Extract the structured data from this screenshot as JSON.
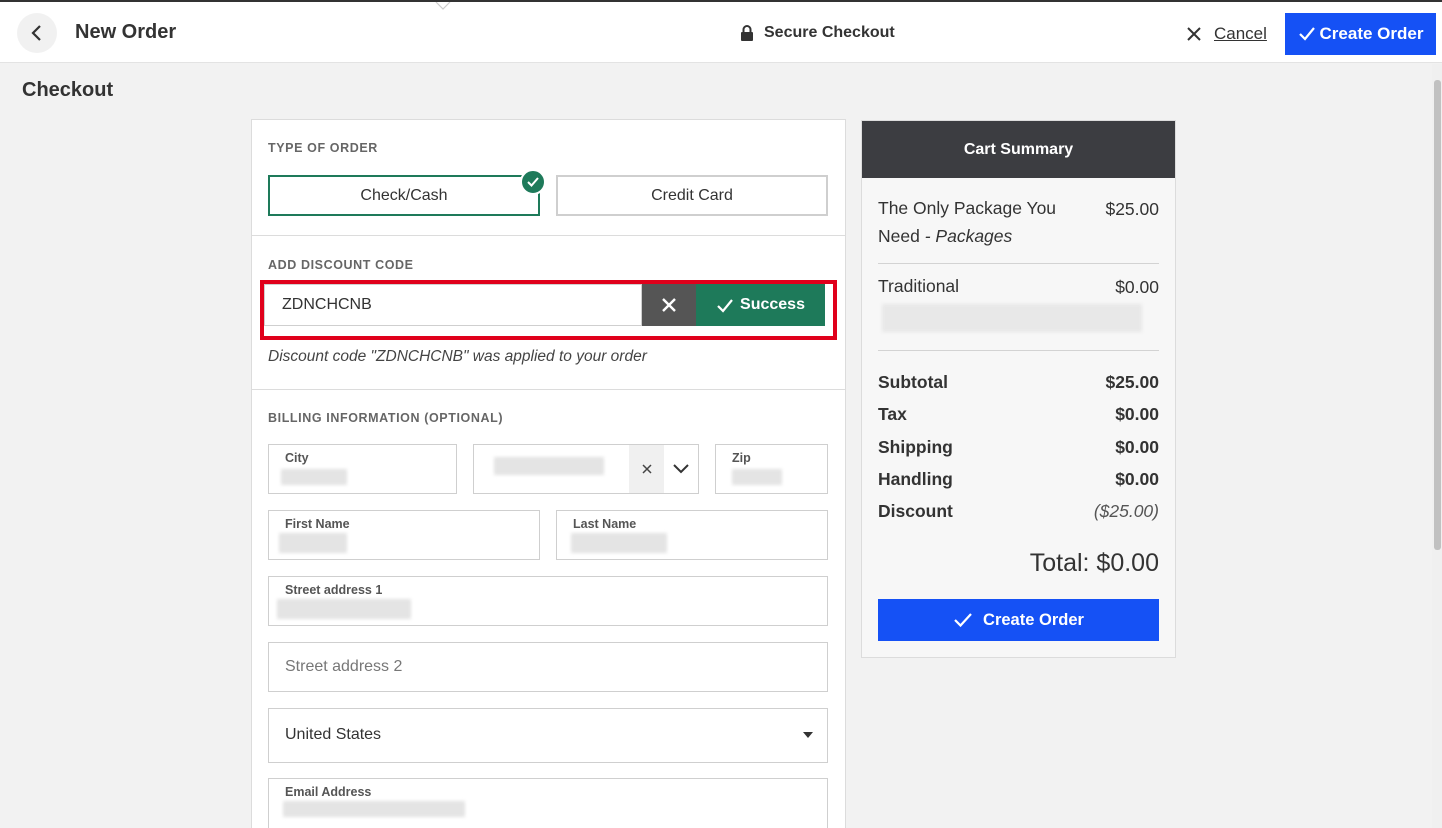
{
  "header": {
    "title": "New Order",
    "secure_label": "Secure Checkout",
    "cancel_label": "Cancel",
    "create_label": "Create Order"
  },
  "page": {
    "heading": "Checkout"
  },
  "order_type": {
    "label": "TYPE OF ORDER",
    "options": [
      "Check/Cash",
      "Credit Card"
    ],
    "selected": "Check/Cash"
  },
  "discount": {
    "label": "ADD DISCOUNT CODE",
    "code": "ZDNCHCNB",
    "status_label": "Success",
    "message": "Discount code \"ZDNCHCNB\" was applied to your order"
  },
  "billing": {
    "label": "BILLING INFORMATION (OPTIONAL)",
    "city_label": "City",
    "zip_label": "Zip",
    "first_name_label": "First Name",
    "last_name_label": "Last Name",
    "street1_label": "Street address 1",
    "street2_placeholder": "Street address 2",
    "country": "United States",
    "email_label": "Email Address"
  },
  "cart": {
    "title": "Cart Summary",
    "items": [
      {
        "name": "The Only Package You Need",
        "category": "Packages",
        "price": "$25.00"
      },
      {
        "name": "Traditional",
        "price": "$0.00"
      }
    ],
    "summary": [
      {
        "label": "Subtotal",
        "value": "$25.00"
      },
      {
        "label": "Tax",
        "value": "$0.00"
      },
      {
        "label": "Shipping",
        "value": "$0.00"
      },
      {
        "label": "Handling",
        "value": "$0.00"
      },
      {
        "label": "Discount",
        "value": "($25.00)"
      }
    ],
    "total_label": "Total: $0.00",
    "create_label": "Create Order"
  },
  "colors": {
    "primary": "#1551f5",
    "success": "#1e7a5a",
    "highlight": "#e0001b",
    "cart_header": "#3c3d41"
  }
}
